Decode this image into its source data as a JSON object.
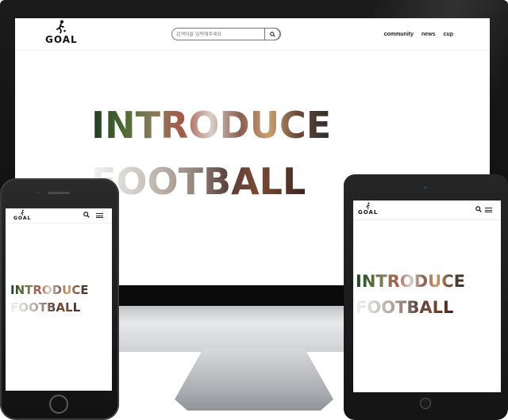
{
  "site": {
    "logo_text": "GOAL",
    "hero_line1": "INTRODUCE",
    "hero_line2": "FOOTBALL"
  },
  "search": {
    "placeholder": "검색어를 입력해주세요"
  },
  "nav": {
    "items": [
      {
        "label": "community"
      },
      {
        "label": "news"
      },
      {
        "label": "cup"
      }
    ]
  },
  "icons": {
    "logo": "soccer-player-icon",
    "search": "search-icon",
    "menu": "hamburger-menu-icon"
  },
  "colors": {
    "device_bezel": "#111111",
    "screen_bg": "#ffffff",
    "text_primary": "#111111"
  }
}
